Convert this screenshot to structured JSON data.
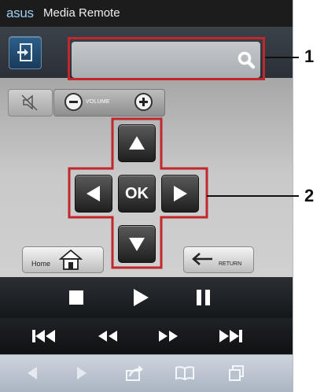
{
  "app": {
    "brand": "asus",
    "title": "Media Remote"
  },
  "volume": {
    "label": "VOLUME"
  },
  "dpad": {
    "ok_label": "OK"
  },
  "nav": {
    "home_label": "Home",
    "return_label": "RETURN"
  },
  "callouts": [
    "1",
    "2"
  ],
  "colors": {
    "highlight": "#c1272d",
    "accent": "#9fcef0"
  },
  "icons": {
    "exit": "exit-door-icon",
    "search": "search-icon",
    "mute": "mute-speaker-icon",
    "stop": "stop-icon",
    "play": "play-icon",
    "pause": "pause-icon",
    "skip_prev": "skip-previous-icon",
    "rewind": "rewind-icon",
    "fast_forward": "fast-forward-icon",
    "skip_next": "skip-next-icon",
    "back": "back-arrow-icon",
    "forward": "forward-arrow-icon",
    "share": "share-icon",
    "bookmarks": "bookmarks-icon",
    "tabs": "tabs-icon"
  }
}
